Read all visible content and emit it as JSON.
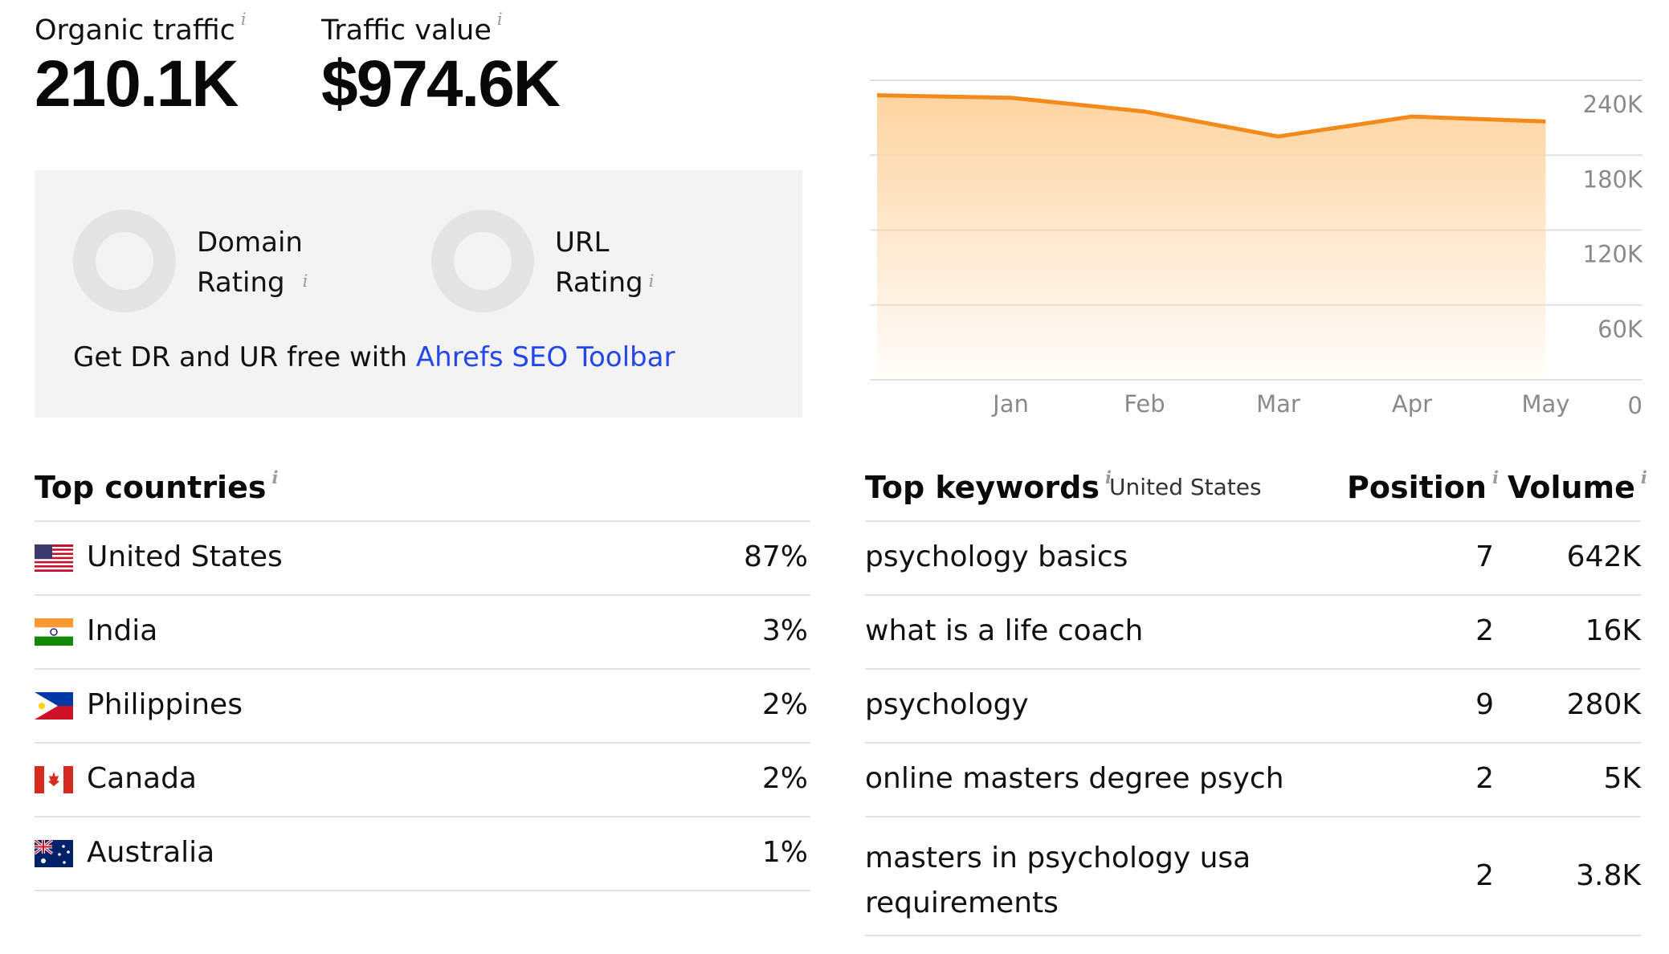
{
  "metrics": {
    "organic_traffic_label": "Organic traffic",
    "organic_traffic_value": "210.1K",
    "traffic_value_label": "Traffic value",
    "traffic_value_value": "$974.6K",
    "info_glyph": "i"
  },
  "ratings": {
    "domain_rating_line1": "Domain",
    "domain_rating_line2": "Rating",
    "url_rating_line1": "URL",
    "url_rating_line2": "Rating",
    "promo_text": "Get DR and UR free with ",
    "promo_link": "Ahrefs SEO Toolbar"
  },
  "colors": {
    "accent_line": "#f48a1c",
    "link": "#2547e8",
    "fill_top": "#fdd8a8"
  },
  "chart_data": {
    "type": "area",
    "x": [
      "Jan",
      "Feb",
      "Mar",
      "Apr",
      "May"
    ],
    "x_tick_labels": [
      "Jan",
      "Feb",
      "Mar",
      "Apr",
      "May"
    ],
    "y_tick_labels": [
      "240K",
      "180K",
      "120K",
      "60K",
      "0"
    ],
    "ylim": [
      0,
      240000
    ],
    "series": [
      {
        "values": [
          228000,
          226000,
          215000,
          195000,
          211000,
          207000
        ]
      }
    ],
    "grid": true
  },
  "top_countries": {
    "title": "Top countries",
    "rows": [
      {
        "country": "United States",
        "share": "87%",
        "flag": "us-flag"
      },
      {
        "country": "India",
        "share": "3%",
        "flag": "india-flag"
      },
      {
        "country": "Philippines",
        "share": "2%",
        "flag": "philippines-flag"
      },
      {
        "country": "Canada",
        "share": "2%",
        "flag": "canada-flag"
      },
      {
        "country": "Australia",
        "share": "1%",
        "flag": "australia-flag"
      }
    ]
  },
  "top_keywords": {
    "title": "Top keywords",
    "region": "United States",
    "position_header": "Position",
    "volume_header": "Volume",
    "rows": [
      {
        "keyword": "psychology basics",
        "position": "7",
        "volume": "642K"
      },
      {
        "keyword": "what is a life coach",
        "position": "2",
        "volume": "16K"
      },
      {
        "keyword": "psychology",
        "position": "9",
        "volume": "280K"
      },
      {
        "keyword": "online masters degree psych",
        "position": "2",
        "volume": "5K"
      },
      {
        "keyword_line1": "masters in psychology usa",
        "keyword_line2": "requirements",
        "position": "2",
        "volume": "3.8K"
      }
    ]
  }
}
